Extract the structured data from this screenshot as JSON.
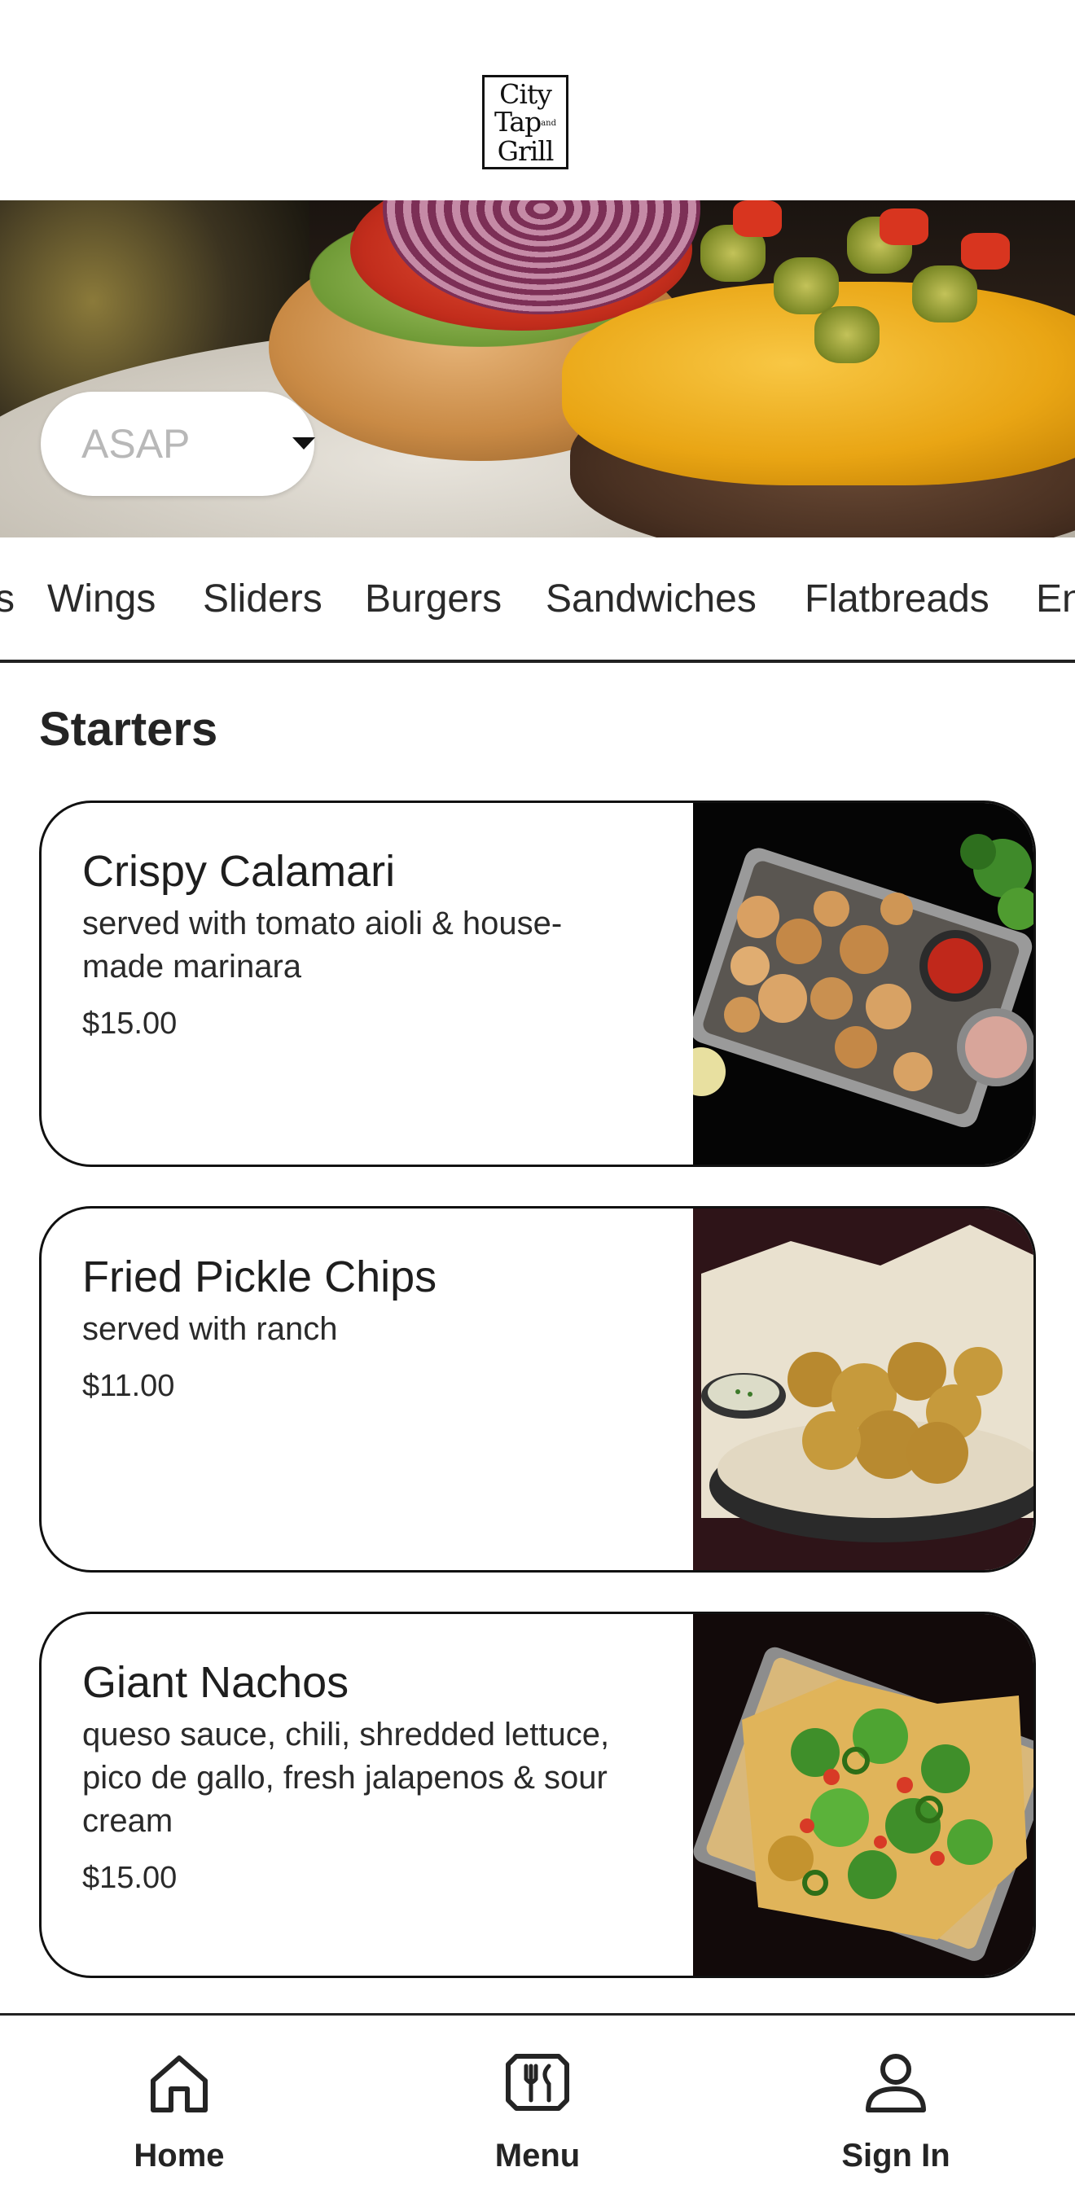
{
  "brand": {
    "logo_lines": [
      "City",
      "Tap",
      "Grill"
    ],
    "logo_and": "and"
  },
  "order_time": {
    "value": "ASAP"
  },
  "categories": [
    "s",
    "Wings",
    "Sliders",
    "Burgers",
    "Sandwiches",
    "Flatbreads",
    "En"
  ],
  "section": {
    "title": "Starters"
  },
  "items": [
    {
      "name": "Crispy Calamari",
      "desc_lines": [
        "served with tomato aioli & house-",
        "made marinara"
      ],
      "price": "$15.00"
    },
    {
      "name": "Fried Pickle Chips",
      "desc_lines": [
        "served with ranch"
      ],
      "price": "$11.00"
    },
    {
      "name": "Giant Nachos",
      "desc_lines": [
        "queso sauce, chili, shredded lettuce,",
        "pico de gallo, fresh jalapenos & sour",
        "cream"
      ],
      "price": "$15.00"
    }
  ],
  "bottom_nav": [
    {
      "label": "Home",
      "icon": "home-icon"
    },
    {
      "label": "Menu",
      "icon": "menu-utensils-icon"
    },
    {
      "label": "Sign In",
      "icon": "user-icon"
    }
  ]
}
